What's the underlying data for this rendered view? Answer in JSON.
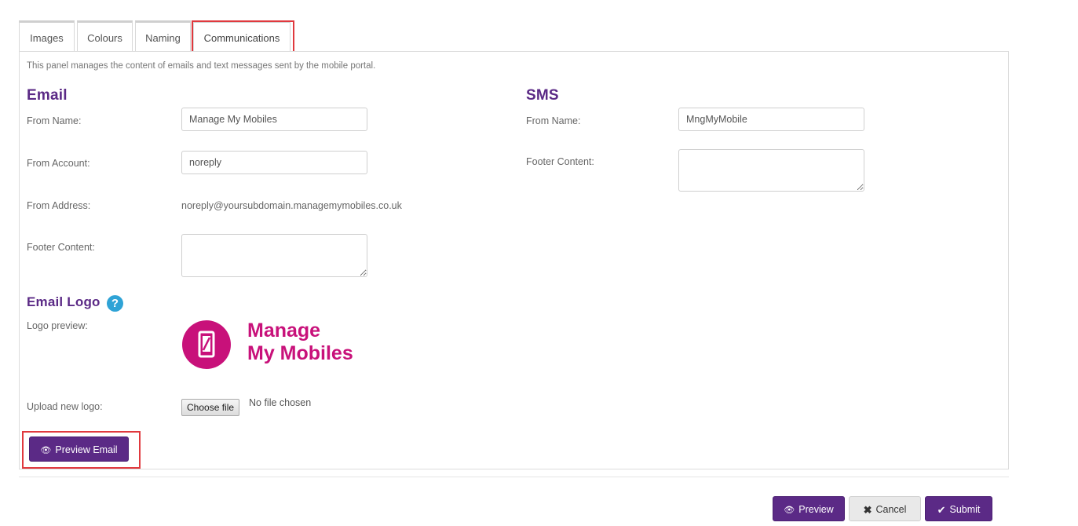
{
  "tabs": [
    {
      "label": "Images"
    },
    {
      "label": "Colours"
    },
    {
      "label": "Naming"
    },
    {
      "label": "Communications",
      "active": true
    }
  ],
  "panel": {
    "description": "This panel manages the content of emails and text messages sent by the mobile portal."
  },
  "email": {
    "title": "Email",
    "from_name_label": "From Name:",
    "from_name_value": "Manage My Mobiles",
    "from_account_label": "From Account:",
    "from_account_value": "noreply",
    "from_address_label": "From Address:",
    "from_address_value": "noreply@yoursubdomain.managemymobiles.co.uk",
    "footer_label": "Footer Content:",
    "footer_value": ""
  },
  "sms": {
    "title": "SMS",
    "from_name_label": "From Name:",
    "from_name_value": "MngMyMobile",
    "footer_label": "Footer Content:",
    "footer_value": ""
  },
  "logo_section": {
    "title": "Email Logo",
    "help_icon": "question-circle-icon",
    "help_glyph": "?",
    "preview_label": "Logo preview:",
    "logo_line1": "Manage",
    "logo_line2": "My Mobiles",
    "upload_label": "Upload new logo:",
    "choose_file_label": "Choose file",
    "no_file_text": "No file chosen"
  },
  "preview_email_button": {
    "label": "Preview Email",
    "icon": "eye-icon"
  },
  "footer_buttons": {
    "preview_label": "Preview",
    "cancel_label": "Cancel",
    "submit_label": "Submit"
  },
  "colors": {
    "brand_purple": "#5b2a86",
    "logo_magenta": "#c8117a",
    "highlight_red": "#e0393e",
    "help_blue": "#2fa3d6"
  }
}
